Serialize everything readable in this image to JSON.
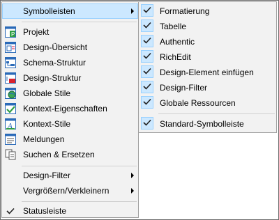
{
  "main_menu": {
    "symbolleisten": "Symbolleisten",
    "projekt": "Projekt",
    "design_uebersicht": "Design-Übersicht",
    "schema_struktur": "Schema-Struktur",
    "design_struktur": "Design-Struktur",
    "globale_stile": "Globale Stile",
    "kontext_eigenschaften": "Kontext-Eigenschaften",
    "kontext_stile": "Kontext-Stile",
    "meldungen": "Meldungen",
    "suchen_ersetzen": "Suchen & Ersetzen",
    "design_filter": "Design-Filter",
    "vergroessern": "Vergrößern/Verkleinern",
    "statusleiste": "Statusleiste"
  },
  "sub_menu": {
    "formatierung": "Formatierung",
    "tabelle": "Tabelle",
    "authentic": "Authentic",
    "richedit": "RichEdit",
    "design_element": "Design-Element einfügen",
    "design_filter": "Design-Filter",
    "globale_ressourcen": "Globale Ressourcen",
    "standard": "Standard-Symbolleiste"
  },
  "colors": {
    "highlight": "#cce8ff",
    "highlight_border": "#99d1ff",
    "menu_bg": "#f2f2f2"
  }
}
